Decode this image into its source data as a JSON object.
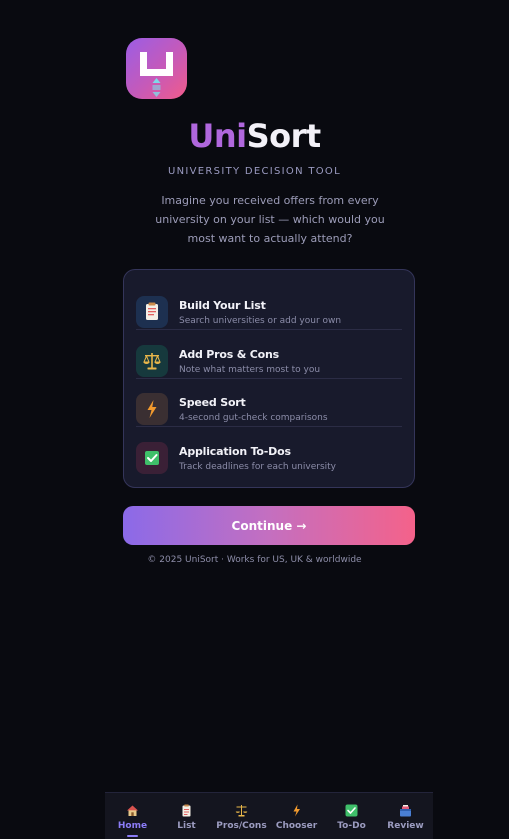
{
  "app": {
    "title_part1": "Uni",
    "title_part2": "Sort",
    "subtitle": "UNIVERSITY DECISION TOOL",
    "intro": "Imagine you received offers from every university on your list — which would you most want to actually attend?"
  },
  "features": [
    {
      "icon": "clipboard-icon",
      "title": "Build Your List",
      "desc": "Search universities or add your own"
    },
    {
      "icon": "scales-icon",
      "title": "Add Pros & Cons",
      "desc": "Note what matters most to you"
    },
    {
      "icon": "lightning-icon",
      "title": "Speed Sort",
      "desc": "4-second gut-check comparisons"
    },
    {
      "icon": "checkbox-icon",
      "title": "Application To-Dos",
      "desc": "Track deadlines for each university"
    }
  ],
  "continue_label": "Continue →",
  "footer": "© 2025 UniSort · Works for US, UK & worldwide",
  "nav": [
    {
      "icon": "house-icon",
      "label": "Home",
      "active": true
    },
    {
      "icon": "clipboard-icon",
      "label": "List",
      "active": false
    },
    {
      "icon": "scales-icon",
      "label": "Pros/Cons",
      "active": false
    },
    {
      "icon": "lightning-icon",
      "label": "Chooser",
      "active": false
    },
    {
      "icon": "checkbox-icon",
      "label": "To-Do",
      "active": false
    },
    {
      "icon": "ballot-box-icon",
      "label": "Review",
      "active": false
    }
  ],
  "colors": {
    "background": "#090a10",
    "accent_purple": "#9b5de5",
    "accent_pink": "#f15b8a",
    "nav_active": "#8b7cf6"
  }
}
